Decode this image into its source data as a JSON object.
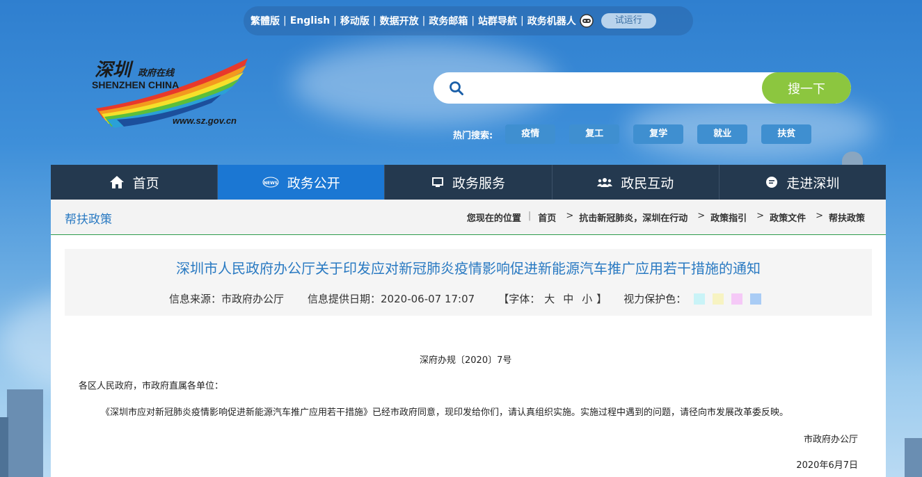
{
  "topbar": {
    "links": [
      "繁體版",
      "English",
      "移动版",
      "数据开放",
      "政务邮箱",
      "站群导航",
      "政务机器人"
    ],
    "trial_label": "试运行"
  },
  "logo": {
    "title_cn": "深圳",
    "subtitle_cn": "政府在线",
    "title_en": "SHENZHEN CHINA",
    "url": "www.sz.gov.cn"
  },
  "search": {
    "placeholder": "",
    "button_label": "搜一下"
  },
  "hot_search": {
    "label": "热门搜索:",
    "tags": [
      "疫情",
      "复工",
      "复学",
      "就业",
      "扶贫"
    ]
  },
  "nav": {
    "items": [
      {
        "label": "首页",
        "icon": "home-icon"
      },
      {
        "label": "政务公开",
        "icon": "news-icon"
      },
      {
        "label": "政务服务",
        "icon": "monitor-icon"
      },
      {
        "label": "政民互动",
        "icon": "users-icon"
      },
      {
        "label": "走进深圳",
        "icon": "chat-icon"
      }
    ],
    "active_index": 1
  },
  "breadcrumb": {
    "section_title": "帮扶政策",
    "location_label": "您现在的位置",
    "items": [
      "首页",
      "抗击新冠肺炎，深圳在行动",
      "政策指引",
      "政策文件",
      "帮扶政策"
    ]
  },
  "article": {
    "title": "深圳市人民政府办公厅关于印发应对新冠肺炎疫情影响促进新能源汽车推广应用若干措施的通知",
    "source_label": "信息来源：市政府办公厅",
    "date_label": "信息提供日期：2020-06-07 17:07",
    "font_label_open": "【字体：",
    "font_large": "大",
    "font_medium": "中",
    "font_small": "小",
    "font_label_close": "】",
    "eye_protect_label": "视力保护色：",
    "swatch_colors": [
      "#c9f3f7",
      "#f7f3c2",
      "#f5c9f7",
      "#a9ccf5"
    ],
    "doc_number": "深府办规〔2020〕7号",
    "addressee": "各区人民政府，市政府直属各单位：",
    "paragraph": "《深圳市应对新冠肺炎疫情影响促进新能源汽车推广应用若干措施》已经市政府同意，现印发给你们，请认真组织实施。实施过程中遇到的问题，请径向市发展改革委反映。",
    "signature": "市政府办公厅",
    "sign_date": "2020年6月7日"
  }
}
